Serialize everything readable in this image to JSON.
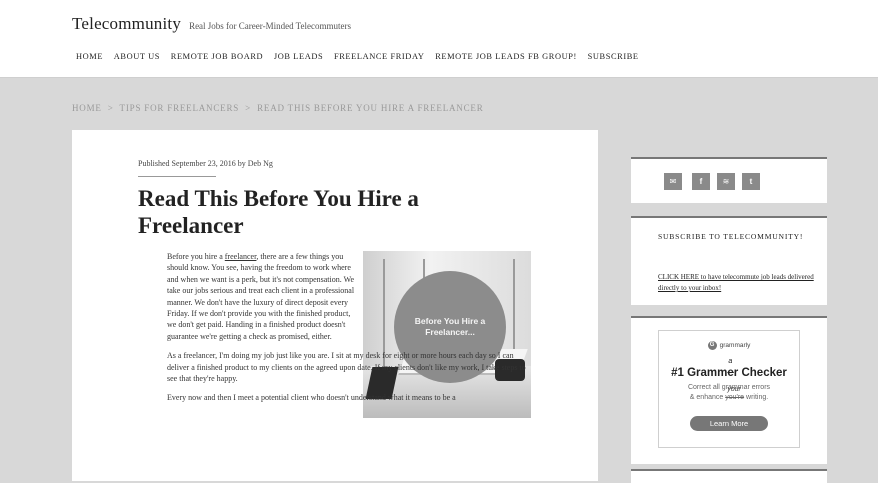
{
  "site": {
    "name": "Telecommunity",
    "tagline": "Real Jobs for Career-Minded Telecommuters"
  },
  "nav": [
    "HOME",
    "ABOUT US",
    "REMOTE JOB BOARD",
    "JOB LEADS",
    "FREELANCE FRIDAY",
    "REMOTE JOB LEADS FB GROUP!",
    "SUBSCRIBE"
  ],
  "breadcrumb": {
    "home": "HOME",
    "category": "TIPS FOR FREELANCERS",
    "current": "READ THIS BEFORE YOU HIRE A FREELANCER",
    "separator": ">"
  },
  "article": {
    "byline": "Published September 23, 2016 by Deb Ng",
    "title": "Read This Before You Hire a Freelancer",
    "p1_pre": "Before you hire a ",
    "p1_link": "freelancer",
    "p1_post": ", there are a few things you should know. You see, having the freedom to work where and when we want is a perk, but it's not compensation. We take our jobs serious and treat each client in a professional manner. We don't have the luxury of direct deposit every Friday. If we don't provide you with the finished product, we don't get paid. Handing in a finished product doesn't guarantee we're getting a check as promised, either.",
    "p2": "As a freelancer, I'm doing my job just like you are. I sit at my desk for eight or more hours each day so I can deliver a finished product to my clients on the agreed upon date. If my clients don't like my work, I take steps to see that they're happy.",
    "p3": "Every now and then I meet a potential client who doesn't understand what it means to be a",
    "image_text": "Before You Hire a Freelancer..."
  },
  "sidebar": {
    "social_icons": [
      "email-icon",
      "facebook-icon",
      "rss-icon",
      "twitter-icon"
    ],
    "subscribe_heading": "SUBSCRIBE TO TELECOMMUNITY!",
    "subscribe_link": "CLICK HERE to have telecommute job leads delivered directly to your inbox!",
    "ad": {
      "brand": "grammarly",
      "headline_pre": "#1 Gramm",
      "headline_strike": "e",
      "headline_post": "r Checker",
      "headline_correction": "a",
      "line1": "Correct all grammar errors",
      "line2_pre": "& enhance ",
      "line2_strike": "you're",
      "line2_correction": "your",
      "line2_post": " writing.",
      "button": "Learn More"
    }
  },
  "colors": {
    "page_bg": "#d8d8d8",
    "circle": "#8c8c8c",
    "social_button": "#8a8a8a"
  }
}
